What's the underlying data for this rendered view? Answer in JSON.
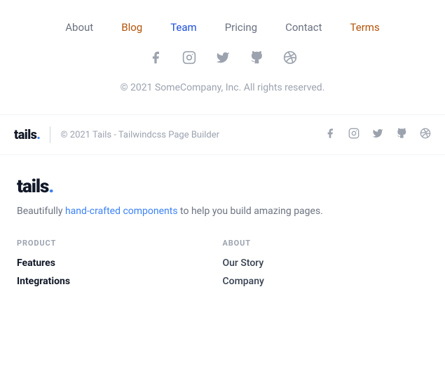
{
  "section1": {
    "nav": [
      {
        "label": "About",
        "color": "colored-about"
      },
      {
        "label": "Blog",
        "color": "colored-blog"
      },
      {
        "label": "Team",
        "color": "colored-team"
      },
      {
        "label": "Pricing",
        "color": "colored-pricing"
      },
      {
        "label": "Contact",
        "color": "colored-contact"
      },
      {
        "label": "Terms",
        "color": "colored-terms"
      }
    ],
    "copyright": "© 2021 SomeCompany, Inc. All rights reserved."
  },
  "section2": {
    "brand": "tails",
    "dot": ".",
    "copyright": "© 2021 Tails - Tailwindcss Page Builder"
  },
  "section3": {
    "brand": "tails",
    "dot": ".",
    "tagline_plain": "Beautifully ",
    "tagline_colored": "hand-crafted components",
    "tagline_end": " to help you build amazing pages.",
    "product_heading": "PRODUCT",
    "product_links": [
      {
        "label": "Features",
        "bold": true
      },
      {
        "label": "Integrations",
        "bold": true
      }
    ],
    "about_heading": "ABOUT",
    "about_links": [
      {
        "label": "Our Story",
        "bold": false
      },
      {
        "label": "Company",
        "bold": false
      }
    ]
  }
}
